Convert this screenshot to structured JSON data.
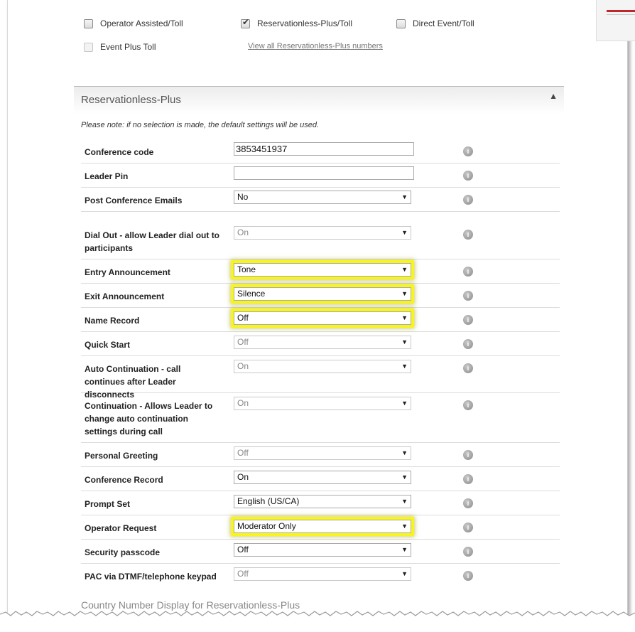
{
  "meta_options": [
    {
      "label": "Operator Assisted/Toll",
      "checked": false,
      "disabled": false
    },
    {
      "label": "Reservationless-Plus/Toll",
      "checked": true,
      "disabled": false
    },
    {
      "label": "Direct Event/Toll",
      "checked": false,
      "disabled": false
    },
    {
      "label": "Event Plus Toll",
      "checked": false,
      "disabled": true
    }
  ],
  "view_all_link": "View all Reservationless-Plus numbers",
  "section": {
    "title": "Reservationless-Plus",
    "collapse_glyph": "▲",
    "note": "Please note: if no selection is made, the default settings will be used."
  },
  "settings": [
    {
      "label": "Conference code",
      "value": "3853451937"
    },
    {
      "label": "Leader Pin",
      "value": ""
    },
    {
      "label": "Post Conference Emails",
      "value": "No"
    },
    {
      "label": "Dial Out - allow Leader dial out to participants",
      "value": "On"
    },
    {
      "label": "Entry Announcement",
      "value": "Tone"
    },
    {
      "label": "Exit Announcement",
      "value": "Silence"
    },
    {
      "label": "Name Record",
      "value": "Off"
    },
    {
      "label": "Quick Start",
      "value": "Off"
    },
    {
      "label": "Auto Continuation - call continues after Leader disconnects",
      "value": "On"
    },
    {
      "label": "Continuation - Allows Leader to change auto continuation settings during call",
      "value": "On"
    },
    {
      "label": "Personal Greeting",
      "value": "Off"
    },
    {
      "label": "Conference Record",
      "value": "On"
    },
    {
      "label": "Prompt Set",
      "value": "English (US/CA)"
    },
    {
      "label": "Operator Request",
      "value": "Moderator Only"
    },
    {
      "label": "Security passcode",
      "value": "Off"
    },
    {
      "label": "PAC via DTMF/telephone keypad",
      "value": "Off"
    }
  ],
  "info_glyph": "i",
  "dropdown_caret": "▼",
  "footer_section_title": "Country Number Display for Reservationless-Plus",
  "colors": {
    "highlight": "#f8f51c",
    "accent_red": "#c0272d"
  }
}
